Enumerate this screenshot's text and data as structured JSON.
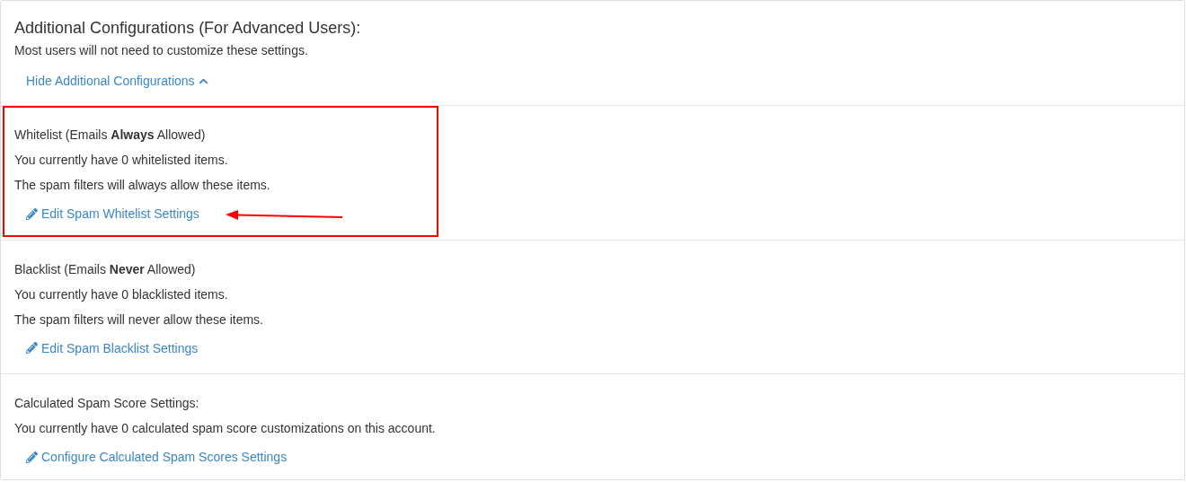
{
  "header": {
    "title": "Additional Configurations (For Advanced Users):",
    "subtitle": "Most users will not need to customize these settings.",
    "toggle_link": "Hide Additional Configurations",
    "expanded": true
  },
  "sections": [
    {
      "title": "Whitelist (Emails **Always** Allowed)",
      "lines": [
        "You currently have 0 whitelisted items.",
        "The spam filters will always allow these items."
      ],
      "link": "Edit Spam Whitelist Settings",
      "highlighted": true
    },
    {
      "title": "Blacklist (Emails **Never** Allowed)",
      "lines": [
        "You currently have 0 blacklisted items.",
        "The spam filters will never allow these items."
      ],
      "link": "Edit Spam Blacklist Settings",
      "highlighted": false
    },
    {
      "title": "Calculated Spam Score Settings:",
      "lines": [
        "You currently have 0 calculated spam score customizations on this account."
      ],
      "link": "Configure Calculated Spam Scores Settings",
      "highlighted": false
    }
  ]
}
